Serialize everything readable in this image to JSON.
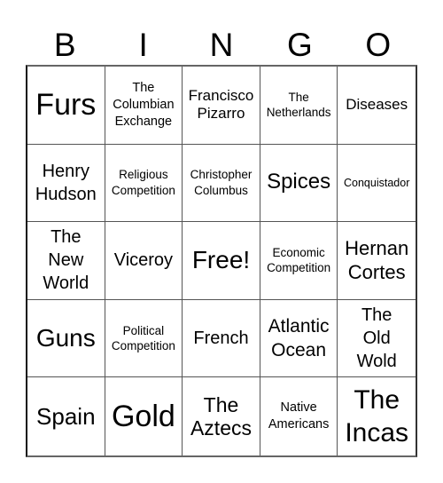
{
  "header": {
    "letters": [
      "B",
      "I",
      "N",
      "G",
      "O"
    ]
  },
  "board": {
    "rows": [
      [
        "Furs",
        "The\nColumbian\nExchange",
        "Francisco\nPizarro",
        "The\nNetherlands",
        "Diseases"
      ],
      [
        "Henry\nHudson",
        "Religious\nCompetition",
        "Christopher\nColumbus",
        "Spices",
        "Conquistador"
      ],
      [
        "The\nNew\nWorld",
        "Viceroy",
        "Free!",
        "Economic\nCompetition",
        "Hernan\nCortes"
      ],
      [
        "Guns",
        "Political\nCompetition",
        "French",
        "Atlantic\nOcean",
        "The\nOld\nWold"
      ],
      [
        "Spain",
        "Gold",
        "The\nAztecs",
        "Native\nAmericans",
        "The\nIncas"
      ]
    ]
  }
}
